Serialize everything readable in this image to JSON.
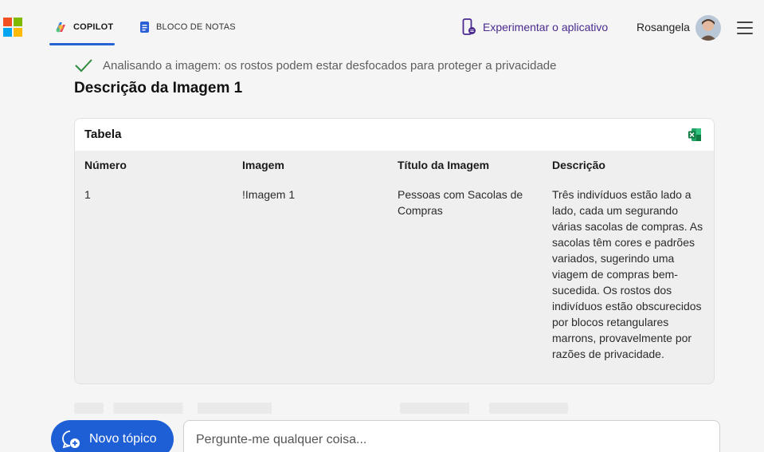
{
  "header": {
    "tabs": [
      {
        "label": "COPILOT",
        "active": true
      },
      {
        "label": "BLOCO DE NOTAS",
        "active": false
      }
    ],
    "try_app_label": "Experimentar o aplicativo",
    "user_name": "Rosangela"
  },
  "status": {
    "text": "Analisando a imagem: os rostos podem estar desfocados para proteger a privacidade"
  },
  "main": {
    "heading": "Descrição da Imagem 1",
    "table": {
      "title": "Tabela",
      "columns": [
        "Número",
        "Imagem",
        "Título da Imagem",
        "Descrição"
      ],
      "rows": [
        [
          "1",
          "!Imagem 1",
          "Pessoas com Sacolas de Compras",
          "Três indivíduos estão lado a lado, cada um segurando várias sacolas de compras. As sacolas têm cores e padrões variados, sugerindo uma viagem de compras bem-sucedida. Os rostos dos indivíduos estão obscurecidos por blocos retangulares marrons, provavelmente por razões de privacidade."
        ]
      ]
    }
  },
  "footer": {
    "new_topic_label": "Novo tópico",
    "input_placeholder": "Pergunte-me qualquer coisa..."
  },
  "colors": {
    "accent": "#1f5fd6",
    "try_app": "#4a2a8f",
    "check": "#2e8b3e"
  }
}
